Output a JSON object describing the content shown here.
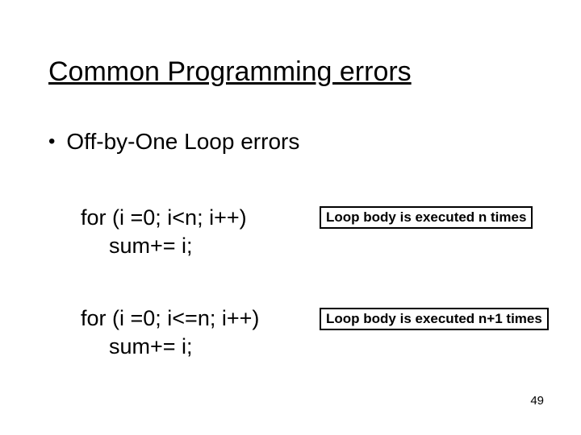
{
  "title": "Common Programming errors",
  "bullet": "Off-by-One Loop errors",
  "code1": {
    "line1": "for (i =0; i<n; i++)",
    "line2": "sum+= i;"
  },
  "note1": "Loop body is executed n times",
  "code2": {
    "line1": "for (i =0; i<=n; i++)",
    "line2": "sum+= i;"
  },
  "note2": "Loop body is executed n+1 times",
  "page_number": "49"
}
